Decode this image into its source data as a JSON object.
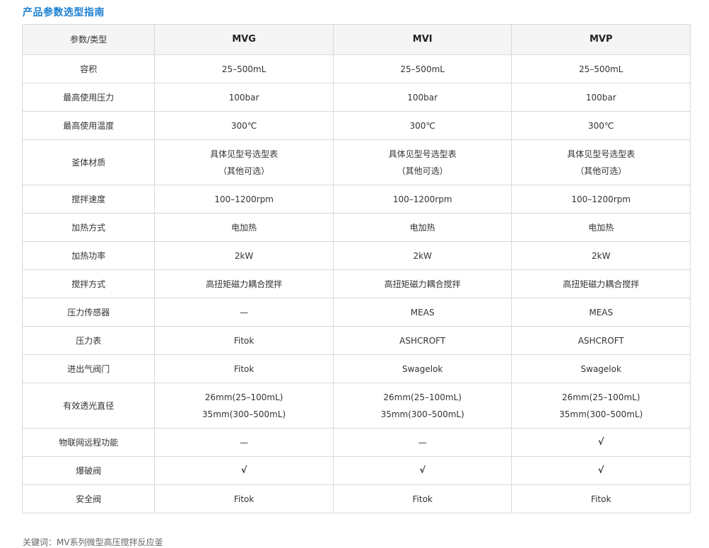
{
  "page": {
    "title": "产品参数选型指南"
  },
  "table": {
    "header": {
      "label": "参数/类型",
      "models": [
        "MVG",
        "MVI",
        "MVP"
      ]
    },
    "rows": [
      {
        "label": "容积",
        "values": [
          [
            "25–500mL"
          ],
          [
            "25–500mL"
          ],
          [
            "25–500mL"
          ]
        ]
      },
      {
        "label": "最高使用压力",
        "values": [
          [
            "100bar"
          ],
          [
            "100bar"
          ],
          [
            "100bar"
          ]
        ]
      },
      {
        "label": "最高使用温度",
        "values": [
          [
            "300℃"
          ],
          [
            "300℃"
          ],
          [
            "300℃"
          ]
        ]
      },
      {
        "label": "釜体材质",
        "values": [
          [
            "具体见型号选型表",
            "（其他可选）"
          ],
          [
            "具体见型号选型表",
            "（其他可选）"
          ],
          [
            "具体见型号选型表",
            "（其他可选）"
          ]
        ]
      },
      {
        "label": "搅拌速度",
        "values": [
          [
            "100–1200rpm"
          ],
          [
            "100–1200rpm"
          ],
          [
            "100–1200rpm"
          ]
        ]
      },
      {
        "label": "加热方式",
        "values": [
          [
            "电加热"
          ],
          [
            "电加热"
          ],
          [
            "电加热"
          ]
        ]
      },
      {
        "label": "加热功率",
        "values": [
          [
            "2kW"
          ],
          [
            "2kW"
          ],
          [
            "2kW"
          ]
        ]
      },
      {
        "label": "搅拌方式",
        "values": [
          [
            "高扭矩磁力耦合搅拌"
          ],
          [
            "高扭矩磁力耦合搅拌"
          ],
          [
            "高扭矩磁力耦合搅拌"
          ]
        ]
      },
      {
        "label": "压力传感器",
        "values": [
          [
            "—"
          ],
          [
            "MEAS"
          ],
          [
            "MEAS"
          ]
        ]
      },
      {
        "label": "压力表",
        "values": [
          [
            "Fitok"
          ],
          [
            "ASHCROFT"
          ],
          [
            "ASHCROFT"
          ]
        ]
      },
      {
        "label": "进出气阀门",
        "values": [
          [
            "Fitok"
          ],
          [
            "Swagelok"
          ],
          [
            "Swagelok"
          ]
        ]
      },
      {
        "label": "有效透光直径",
        "values": [
          [
            "26mm(25–100mL)",
            "35mm(300–500mL)"
          ],
          [
            "26mm(25–100mL)",
            "35mm(300–500mL)"
          ],
          [
            "26mm(25–100mL)",
            "35mm(300–500mL)"
          ]
        ]
      },
      {
        "label": "物联网远程功能",
        "values": [
          [
            "—"
          ],
          [
            "—"
          ],
          [
            "√"
          ]
        ]
      },
      {
        "label": "爆破阀",
        "values": [
          [
            "√"
          ],
          [
            "√"
          ],
          [
            "√"
          ]
        ]
      },
      {
        "label": "安全阀",
        "values": [
          [
            "Fitok"
          ],
          [
            "Fitok"
          ],
          [
            "Fitok"
          ]
        ]
      }
    ]
  },
  "footer": {
    "note": "关键词：MV系列微型高压搅拌反应釜"
  }
}
